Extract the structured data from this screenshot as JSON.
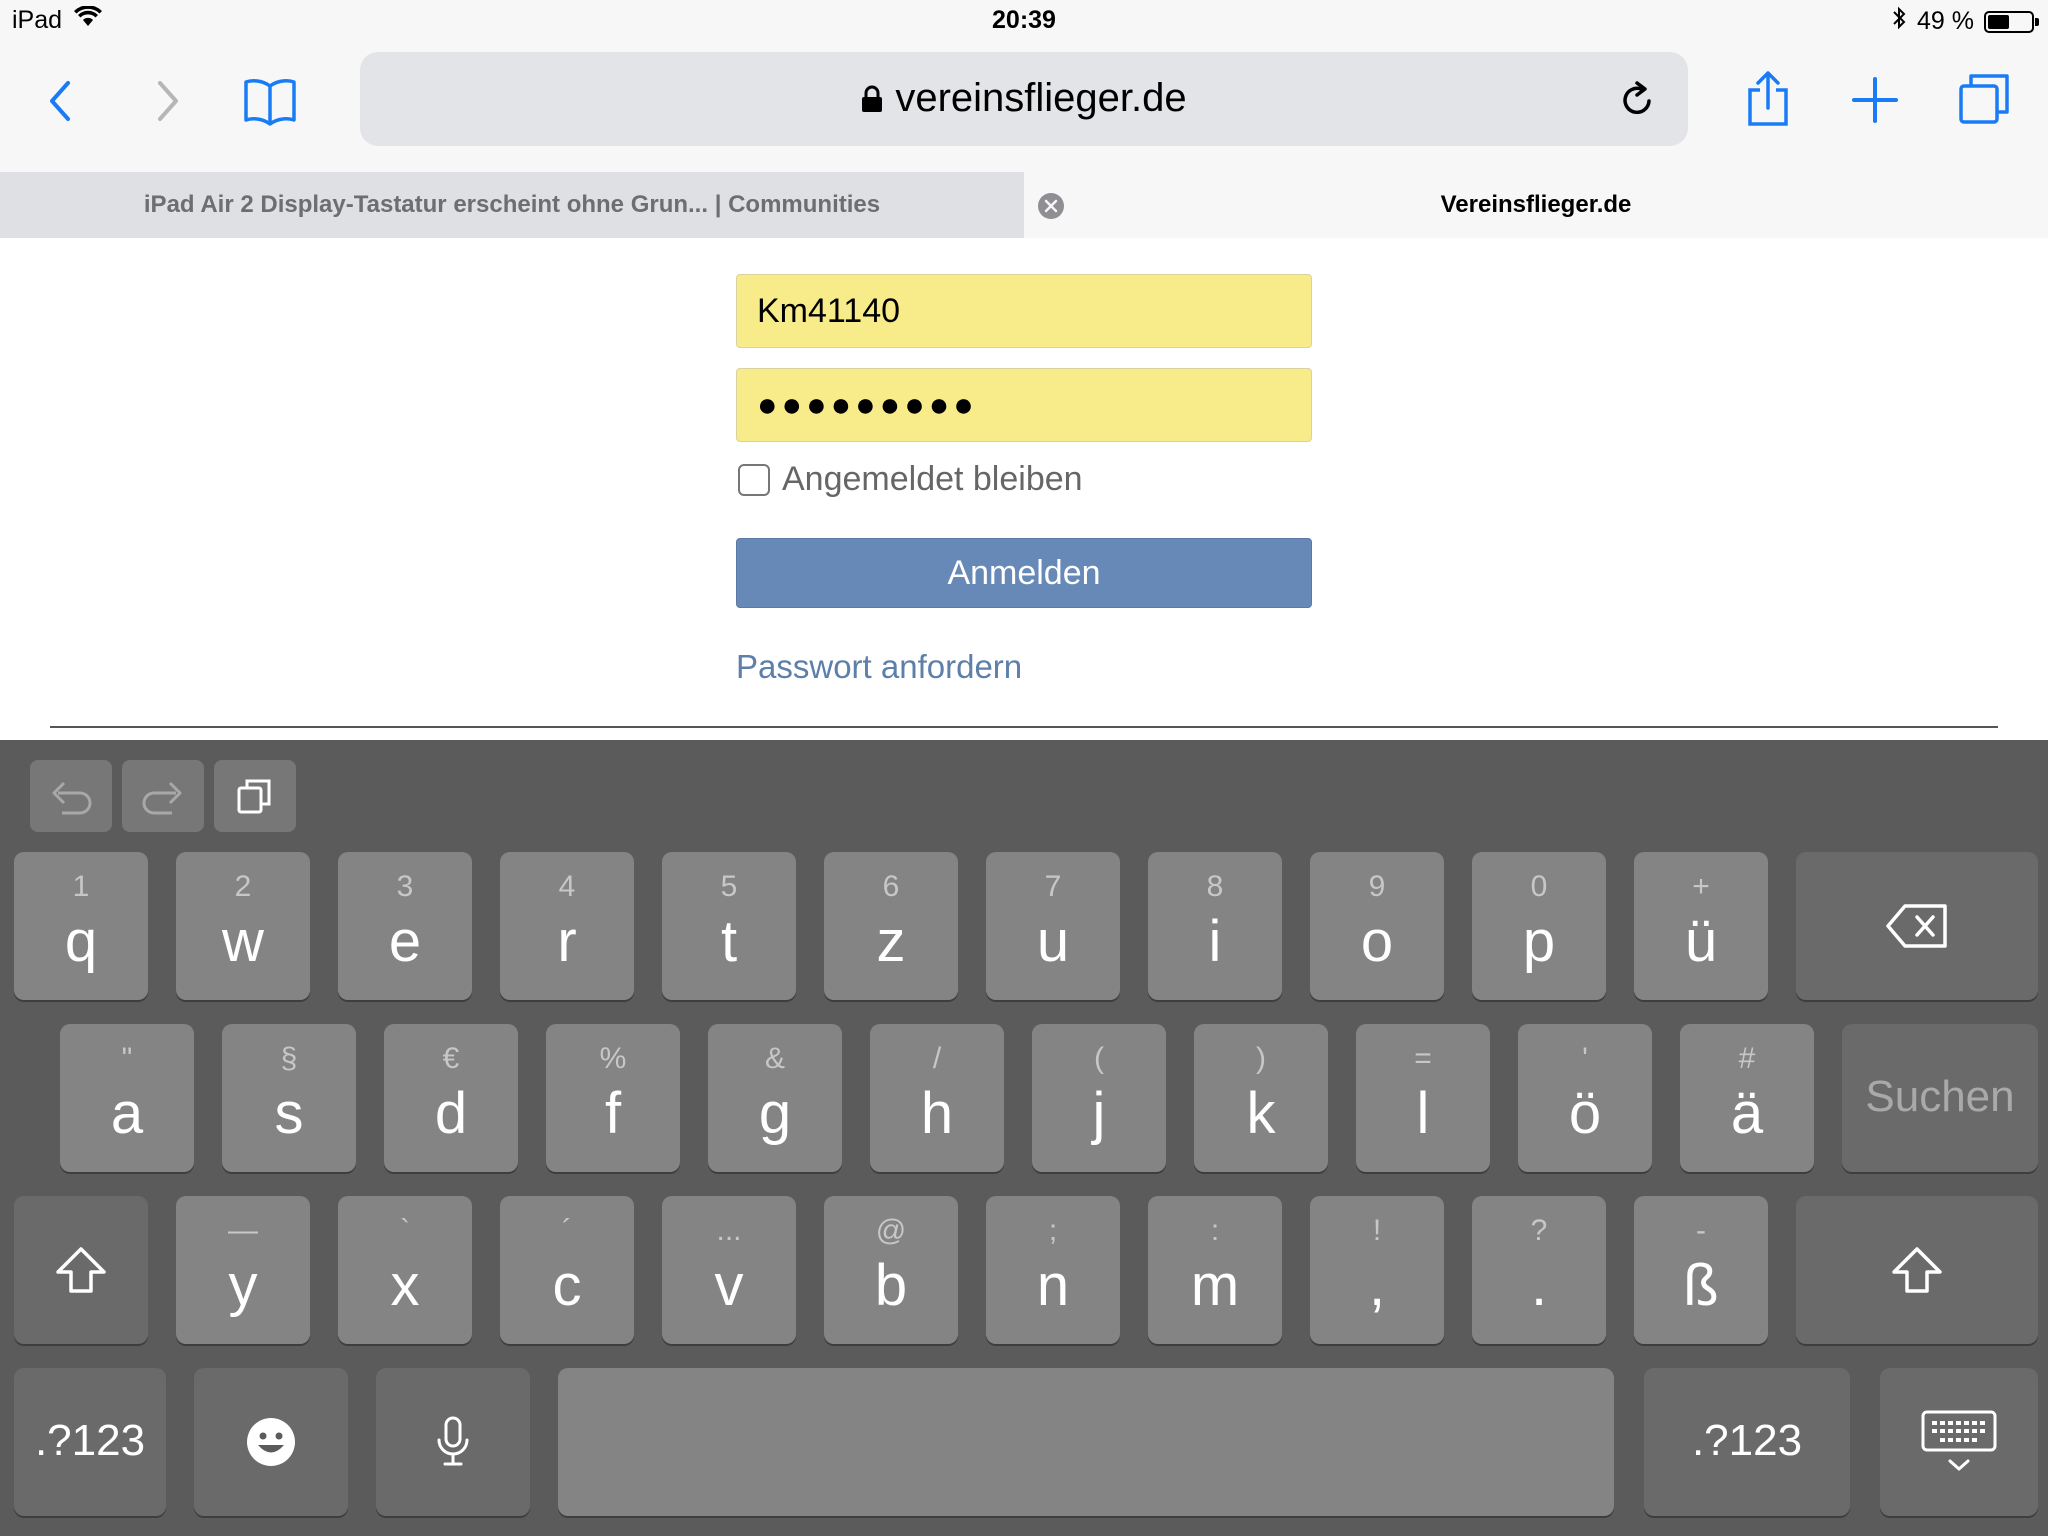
{
  "status": {
    "device": "iPad",
    "time": "20:39",
    "battery_text": "49 %",
    "battery_level": 0.49
  },
  "toolbar": {
    "url": "vereinsflieger.de",
    "back_icon": "chevron-left-icon",
    "forward_icon": "chevron-right-icon",
    "bookmarks_icon": "book-icon",
    "reload_icon": "reload-icon",
    "share_icon": "share-icon",
    "new_tab_icon": "plus-icon",
    "tabs_icon": "tabs-icon"
  },
  "tabs": [
    {
      "title": "iPad Air 2 Display-Tastatur erscheint ohne Grun... | Communities",
      "active": false
    },
    {
      "title": "Vereinsflieger.de",
      "active": true
    }
  ],
  "login": {
    "username": "Km41140",
    "password_mask": "●●●●●●●●●",
    "remember_label": "Angemeldet bleiben",
    "submit_label": "Anmelden",
    "forgot_label": "Passwort anfordern"
  },
  "keyboard": {
    "row1": [
      {
        "top": "1",
        "main": "q"
      },
      {
        "top": "2",
        "main": "w"
      },
      {
        "top": "3",
        "main": "e"
      },
      {
        "top": "4",
        "main": "r"
      },
      {
        "top": "5",
        "main": "t"
      },
      {
        "top": "6",
        "main": "z"
      },
      {
        "top": "7",
        "main": "u"
      },
      {
        "top": "8",
        "main": "i"
      },
      {
        "top": "9",
        "main": "o"
      },
      {
        "top": "0",
        "main": "p"
      },
      {
        "top": "+",
        "main": "ü"
      }
    ],
    "row2": [
      {
        "top": "\"",
        "main": "a"
      },
      {
        "top": "§",
        "main": "s"
      },
      {
        "top": "€",
        "main": "d"
      },
      {
        "top": "%",
        "main": "f"
      },
      {
        "top": "&",
        "main": "g"
      },
      {
        "top": "/",
        "main": "h"
      },
      {
        "top": "(",
        "main": "j"
      },
      {
        "top": ")",
        "main": "k"
      },
      {
        "top": "=",
        "main": "l"
      },
      {
        "top": "'",
        "main": "ö"
      },
      {
        "top": "#",
        "main": "ä"
      }
    ],
    "row3": [
      {
        "top": "—",
        "main": "y"
      },
      {
        "top": "`",
        "main": "x"
      },
      {
        "top": "´",
        "main": "c"
      },
      {
        "top": "...",
        "main": "v"
      },
      {
        "top": "@",
        "main": "b"
      },
      {
        "top": ";",
        "main": "n"
      },
      {
        "top": ":",
        "main": "m"
      },
      {
        "top": "!",
        "main": ","
      },
      {
        "top": "?",
        "main": "."
      },
      {
        "top": "-",
        "main": "ß"
      }
    ],
    "search_label": "Suchen",
    "numbers_label": ".?123"
  }
}
